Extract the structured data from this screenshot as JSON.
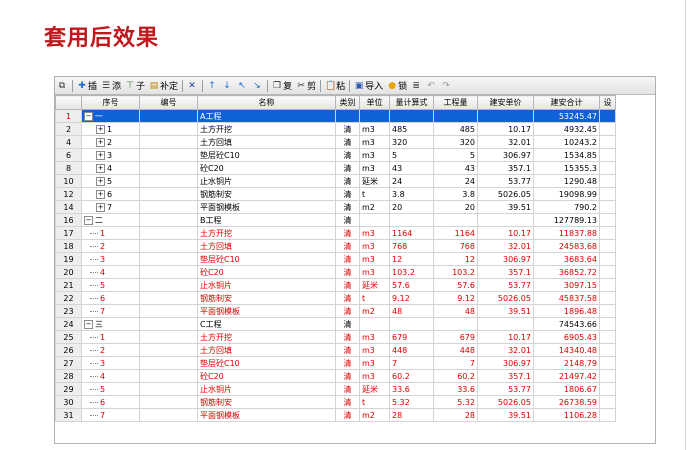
{
  "slide": {
    "title": "套用后效果"
  },
  "toolbar": {
    "items": [
      {
        "name": "copy-tree-button",
        "icon": "copy-icon",
        "label": ""
      },
      {
        "name": "insert-button",
        "icon": "plus-icon",
        "label": "插"
      },
      {
        "name": "add-button",
        "icon": "list-add-icon",
        "label": "添"
      },
      {
        "name": "child-button",
        "icon": "child-icon",
        "label": "子"
      },
      {
        "name": "supplement-button",
        "icon": "supplement-icon",
        "label": "补定"
      },
      {
        "name": "delete-button",
        "icon": "delete-icon",
        "label": ""
      },
      {
        "name": "move-up-button",
        "icon": "arrow-up-icon",
        "label": ""
      },
      {
        "name": "move-down-button",
        "icon": "arrow-down-icon",
        "label": ""
      },
      {
        "name": "promote-button",
        "icon": "arrow-upleft-icon",
        "label": ""
      },
      {
        "name": "demote-button",
        "icon": "arrow-downright-icon",
        "label": ""
      },
      {
        "name": "duplicate-button",
        "icon": "duplicate-icon",
        "label": "复"
      },
      {
        "name": "cut-button",
        "icon": "scissors-icon",
        "label": "剪"
      },
      {
        "name": "paste-button",
        "icon": "paste-icon",
        "label": "粘"
      },
      {
        "name": "import-button",
        "icon": "import-icon",
        "label": "导入"
      },
      {
        "name": "lock-button",
        "icon": "lock-icon",
        "label": "锁"
      },
      {
        "name": "list-button",
        "icon": "list-icon",
        "label": ""
      },
      {
        "name": "undo-button",
        "icon": "undo-icon",
        "label": ""
      },
      {
        "name": "redo-button",
        "icon": "redo-icon",
        "label": ""
      }
    ]
  },
  "grid": {
    "columns": [
      "序号",
      "编号",
      "名称",
      "类别",
      "单位",
      "量计算式",
      "工程量",
      "建安单价",
      "建安合计",
      "设"
    ],
    "rows": [
      {
        "rownum": "1",
        "seq": "一",
        "code": "",
        "name": "A工程",
        "cat": "",
        "unit": "",
        "formula": "",
        "qty": "",
        "price": "",
        "total": "53245.47",
        "level": 0,
        "expander": "−",
        "style": "sel"
      },
      {
        "rownum": "2",
        "seq": "1",
        "code": "",
        "name": "土方开挖",
        "cat": "清",
        "unit": "m3",
        "formula": "485",
        "qty": "485",
        "price": "10.17",
        "total": "4932.45",
        "level": 1,
        "expander": "+",
        "style": "normal"
      },
      {
        "rownum": "4",
        "seq": "2",
        "code": "",
        "name": "土方回填",
        "cat": "清",
        "unit": "m3",
        "formula": "320",
        "qty": "320",
        "price": "32.01",
        "total": "10243.2",
        "level": 1,
        "expander": "+",
        "style": "normal"
      },
      {
        "rownum": "6",
        "seq": "3",
        "code": "",
        "name": "垫层砼C10",
        "cat": "清",
        "unit": "m3",
        "formula": "5",
        "qty": "5",
        "price": "306.97",
        "total": "1534.85",
        "level": 1,
        "expander": "+",
        "style": "normal"
      },
      {
        "rownum": "8",
        "seq": "4",
        "code": "",
        "name": "砼C20",
        "cat": "清",
        "unit": "m3",
        "formula": "43",
        "qty": "43",
        "price": "357.1",
        "total": "15355.3",
        "level": 1,
        "expander": "+",
        "style": "normal"
      },
      {
        "rownum": "10",
        "seq": "5",
        "code": "",
        "name": "止水铜片",
        "cat": "清",
        "unit": "延米",
        "formula": "24",
        "qty": "24",
        "price": "53.77",
        "total": "1290.48",
        "level": 1,
        "expander": "+",
        "style": "normal"
      },
      {
        "rownum": "12",
        "seq": "6",
        "code": "",
        "name": "钢筋制安",
        "cat": "清",
        "unit": "t",
        "formula": "3.8",
        "qty": "3.8",
        "price": "5026.05",
        "total": "19098.99",
        "level": 1,
        "expander": "+",
        "style": "normal"
      },
      {
        "rownum": "14",
        "seq": "7",
        "code": "",
        "name": "平面钢模板",
        "cat": "清",
        "unit": "m2",
        "formula": "20",
        "qty": "20",
        "price": "39.51",
        "total": "790.2",
        "level": 1,
        "expander": "+",
        "style": "normal"
      },
      {
        "rownum": "16",
        "seq": "二",
        "code": "",
        "name": "B工程",
        "cat": "清",
        "unit": "",
        "formula": "",
        "qty": "",
        "price": "",
        "total": "127789.13",
        "level": 0,
        "expander": "−",
        "style": "normal"
      },
      {
        "rownum": "17",
        "seq": "1",
        "code": "",
        "name": "土方开挖",
        "cat": "清",
        "unit": "m3",
        "formula": "1164",
        "qty": "1164",
        "price": "10.17",
        "total": "11837.88",
        "level": 1,
        "expander": "",
        "style": "child"
      },
      {
        "rownum": "18",
        "seq": "2",
        "code": "",
        "name": "土方回填",
        "cat": "清",
        "unit": "m3",
        "formula": "768",
        "qty": "768",
        "price": "32.01",
        "total": "24583.68",
        "level": 1,
        "expander": "",
        "style": "child"
      },
      {
        "rownum": "19",
        "seq": "3",
        "code": "",
        "name": "垫层砼C10",
        "cat": "清",
        "unit": "m3",
        "formula": "12",
        "qty": "12",
        "price": "306.97",
        "total": "3683.64",
        "level": 1,
        "expander": "",
        "style": "child"
      },
      {
        "rownum": "20",
        "seq": "4",
        "code": "",
        "name": "砼C20",
        "cat": "清",
        "unit": "m3",
        "formula": "103.2",
        "qty": "103.2",
        "price": "357.1",
        "total": "36852.72",
        "level": 1,
        "expander": "",
        "style": "child"
      },
      {
        "rownum": "21",
        "seq": "5",
        "code": "",
        "name": "止水铜片",
        "cat": "清",
        "unit": "延米",
        "formula": "57.6",
        "qty": "57.6",
        "price": "53.77",
        "total": "3097.15",
        "level": 1,
        "expander": "",
        "style": "child"
      },
      {
        "rownum": "22",
        "seq": "6",
        "code": "",
        "name": "钢筋制安",
        "cat": "清",
        "unit": "t",
        "formula": "9.12",
        "qty": "9.12",
        "price": "5026.05",
        "total": "45837.58",
        "level": 1,
        "expander": "",
        "style": "child"
      },
      {
        "rownum": "23",
        "seq": "7",
        "code": "",
        "name": "平面钢模板",
        "cat": "清",
        "unit": "m2",
        "formula": "48",
        "qty": "48",
        "price": "39.51",
        "total": "1896.48",
        "level": 1,
        "expander": "",
        "style": "child"
      },
      {
        "rownum": "24",
        "seq": "三",
        "code": "",
        "name": "C工程",
        "cat": "清",
        "unit": "",
        "formula": "",
        "qty": "",
        "price": "",
        "total": "74543.66",
        "level": 0,
        "expander": "−",
        "style": "normal"
      },
      {
        "rownum": "25",
        "seq": "1",
        "code": "",
        "name": "土方开挖",
        "cat": "清",
        "unit": "m3",
        "formula": "679",
        "qty": "679",
        "price": "10.17",
        "total": "6905.43",
        "level": 1,
        "expander": "",
        "style": "child"
      },
      {
        "rownum": "26",
        "seq": "2",
        "code": "",
        "name": "土方回填",
        "cat": "清",
        "unit": "m3",
        "formula": "448",
        "qty": "448",
        "price": "32.01",
        "total": "14340.48",
        "level": 1,
        "expander": "",
        "style": "child"
      },
      {
        "rownum": "27",
        "seq": "3",
        "code": "",
        "name": "垫层砼C10",
        "cat": "清",
        "unit": "m3",
        "formula": "7",
        "qty": "7",
        "price": "306.97",
        "total": "2148.79",
        "level": 1,
        "expander": "",
        "style": "child"
      },
      {
        "rownum": "28",
        "seq": "4",
        "code": "",
        "name": "砼C20",
        "cat": "清",
        "unit": "m3",
        "formula": "60.2",
        "qty": "60.2",
        "price": "357.1",
        "total": "21497.42",
        "level": 1,
        "expander": "",
        "style": "child"
      },
      {
        "rownum": "29",
        "seq": "5",
        "code": "",
        "name": "止水铜片",
        "cat": "清",
        "unit": "延米",
        "formula": "33.6",
        "qty": "33.6",
        "price": "53.77",
        "total": "1806.67",
        "level": 1,
        "expander": "",
        "style": "child"
      },
      {
        "rownum": "30",
        "seq": "6",
        "code": "",
        "name": "钢筋制安",
        "cat": "清",
        "unit": "t",
        "formula": "5.32",
        "qty": "5.32",
        "price": "5026.05",
        "total": "26738.59",
        "level": 1,
        "expander": "",
        "style": "child"
      },
      {
        "rownum": "31",
        "seq": "7",
        "code": "",
        "name": "平面钢模板",
        "cat": "清",
        "unit": "m2",
        "formula": "28",
        "qty": "28",
        "price": "39.51",
        "total": "1106.28",
        "level": 1,
        "expander": "",
        "style": "child"
      }
    ]
  },
  "colors": {
    "title": "#c0181c",
    "selection": "#1060d8",
    "child_text": "#e00000"
  }
}
